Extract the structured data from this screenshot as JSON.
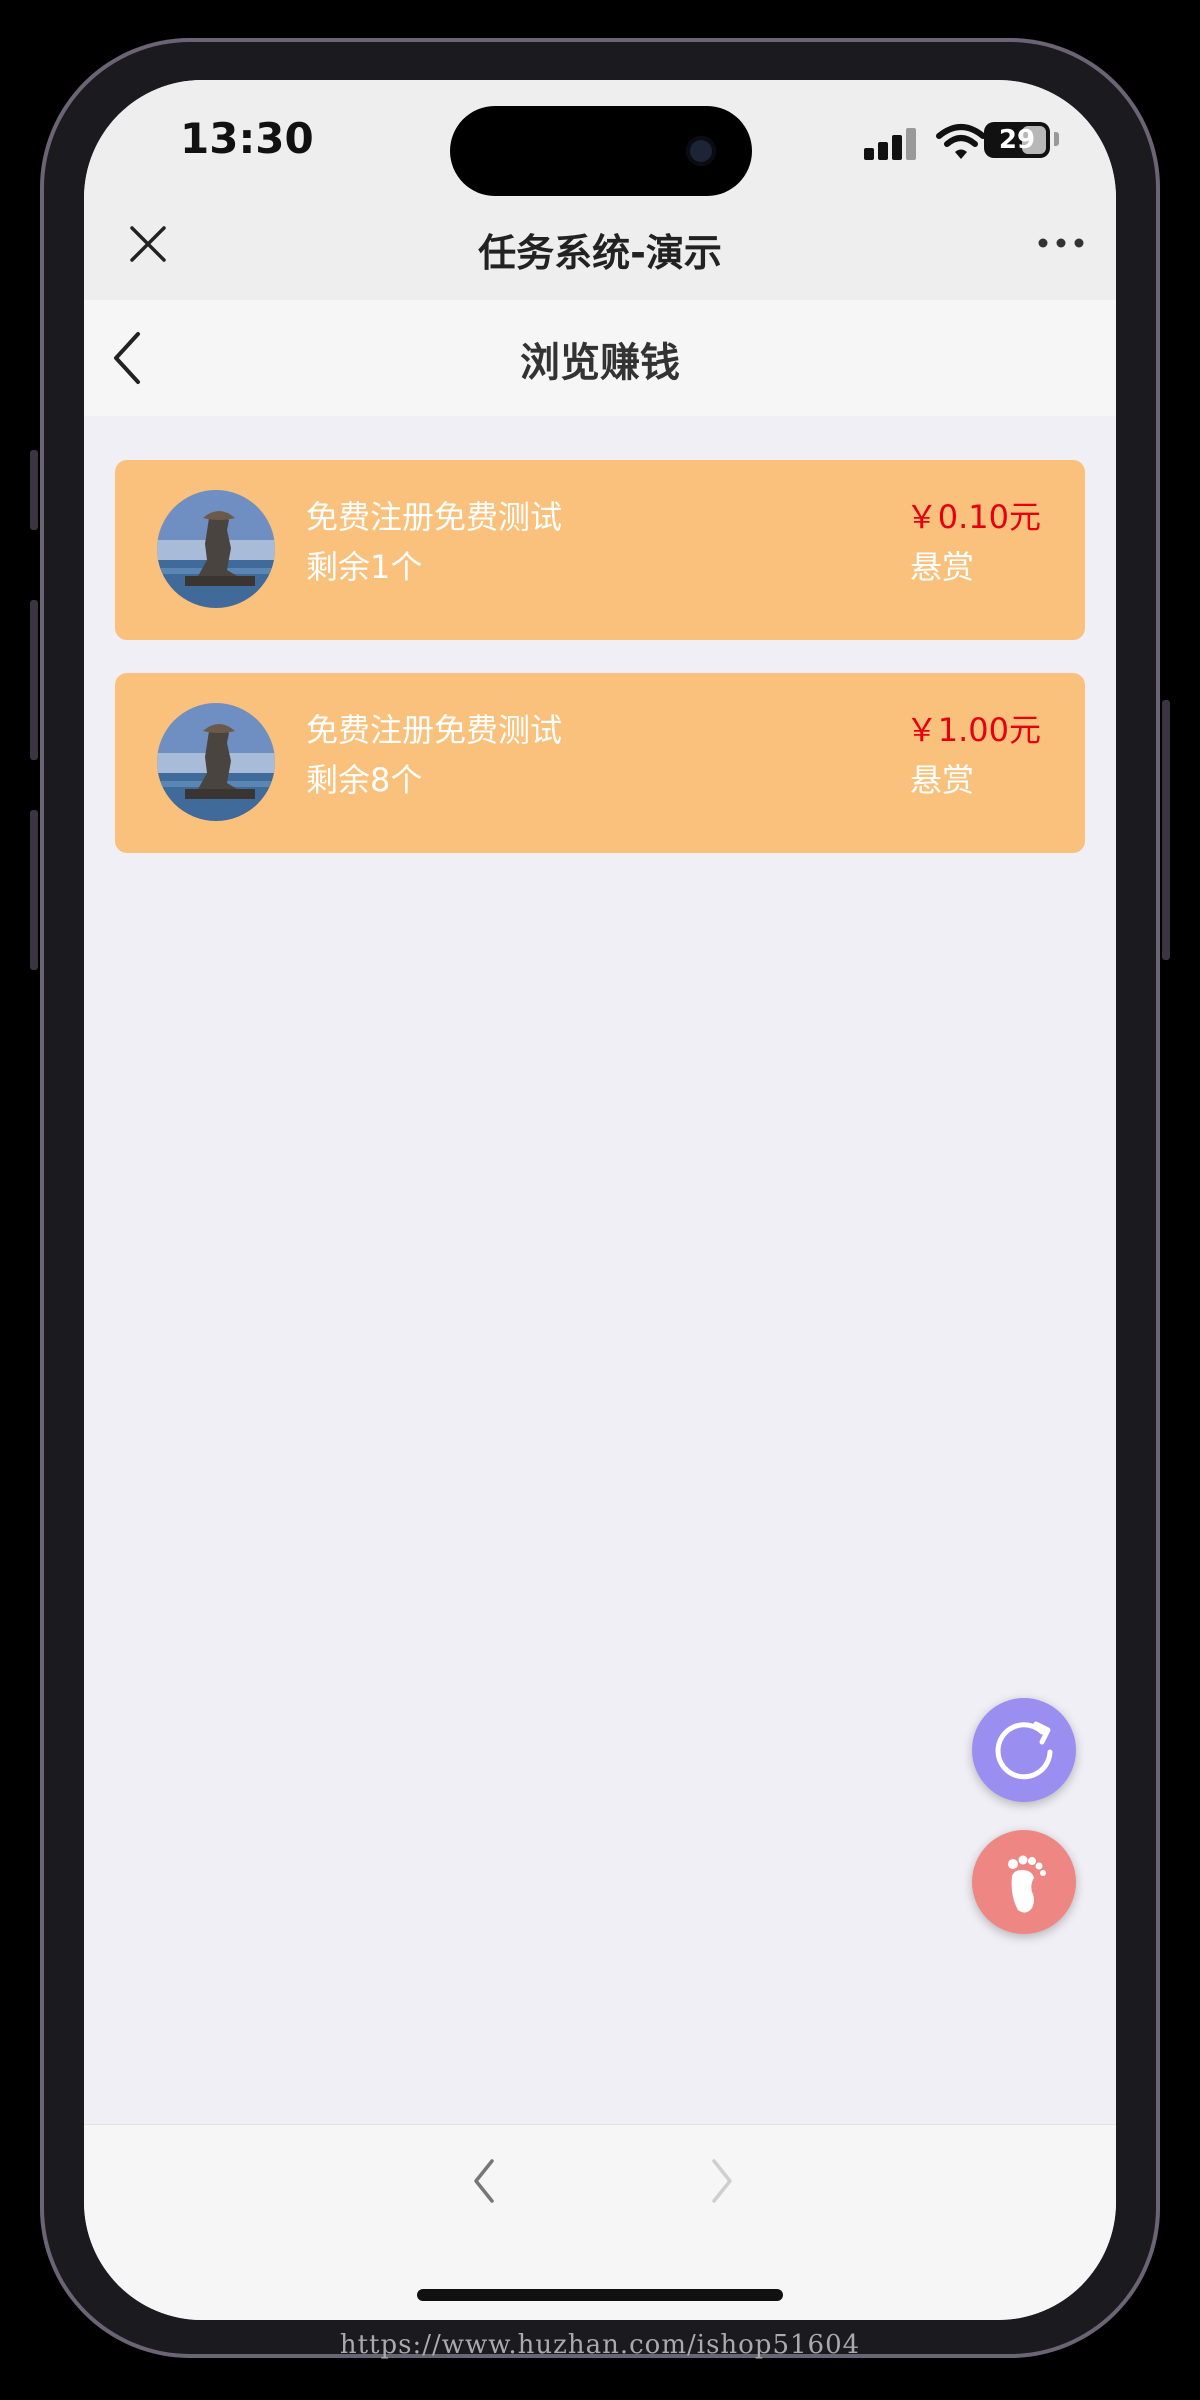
{
  "status_bar": {
    "time": "13:30",
    "battery": "29"
  },
  "mini_program": {
    "title": "任务系统-演示"
  },
  "page": {
    "title": "浏览赚钱"
  },
  "tasks": [
    {
      "name": "免费注册免费测试",
      "remaining": "剩余1个",
      "price": "￥0.10元",
      "reward_label": "悬赏"
    },
    {
      "name": "免费注册免费测试",
      "remaining": "剩余8个",
      "price": "￥1.00元",
      "reward_label": "悬赏"
    }
  ],
  "icons": {
    "close": "close-icon",
    "more": "more-icon",
    "back": "chevron-left-icon",
    "refresh": "refresh-icon",
    "footprint": "footprint-icon",
    "prev": "chevron-left-icon",
    "next": "chevron-right-icon"
  },
  "colors": {
    "card": "#f9c17b",
    "price": "#e60012",
    "refresh_fab": "#9a8ff0",
    "foot_fab": "#ee8784"
  },
  "watermark": "https://www.huzhan.com/ishop51604"
}
